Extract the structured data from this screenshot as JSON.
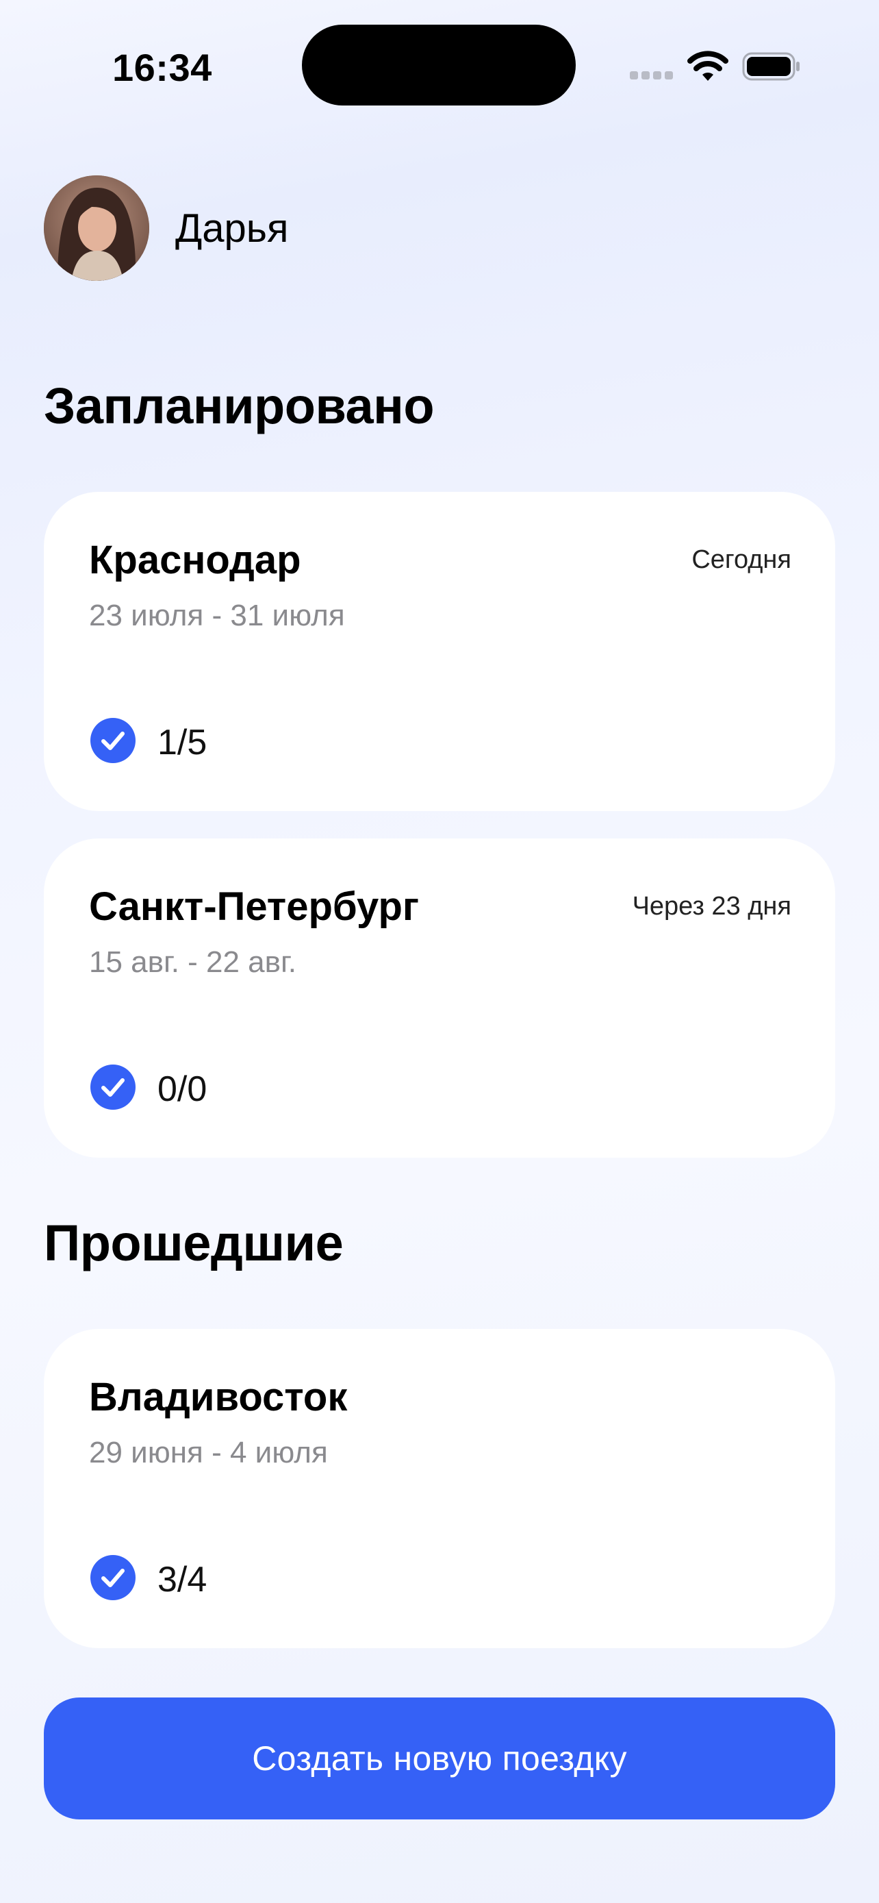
{
  "status_bar": {
    "time": "16:34"
  },
  "profile": {
    "name": "Дарья"
  },
  "sections": {
    "planned_title": "Запланировано",
    "past_title": "Прошедшие"
  },
  "trips": {
    "planned": [
      {
        "city": "Краснодар",
        "dates": "23 июля - 31 июля",
        "when": "Сегодня",
        "checklist": "1/5"
      },
      {
        "city": "Санкт-Петербург",
        "dates": "15 авг. - 22 авг.",
        "when": "Через 23 дня",
        "checklist": "0/0"
      }
    ],
    "past": [
      {
        "city": "Владивосток",
        "dates": "29 июня - 4 июля",
        "checklist": "3/4"
      }
    ]
  },
  "actions": {
    "create_trip_label": "Создать новую поездку"
  },
  "colors": {
    "accent": "#3561F6",
    "card_background": "#FFFFFF",
    "secondary_text": "#8A8A8E"
  },
  "icons": [
    "cellular-signal-icon",
    "wifi-icon",
    "battery-icon",
    "checkmark-circle-icon"
  ]
}
